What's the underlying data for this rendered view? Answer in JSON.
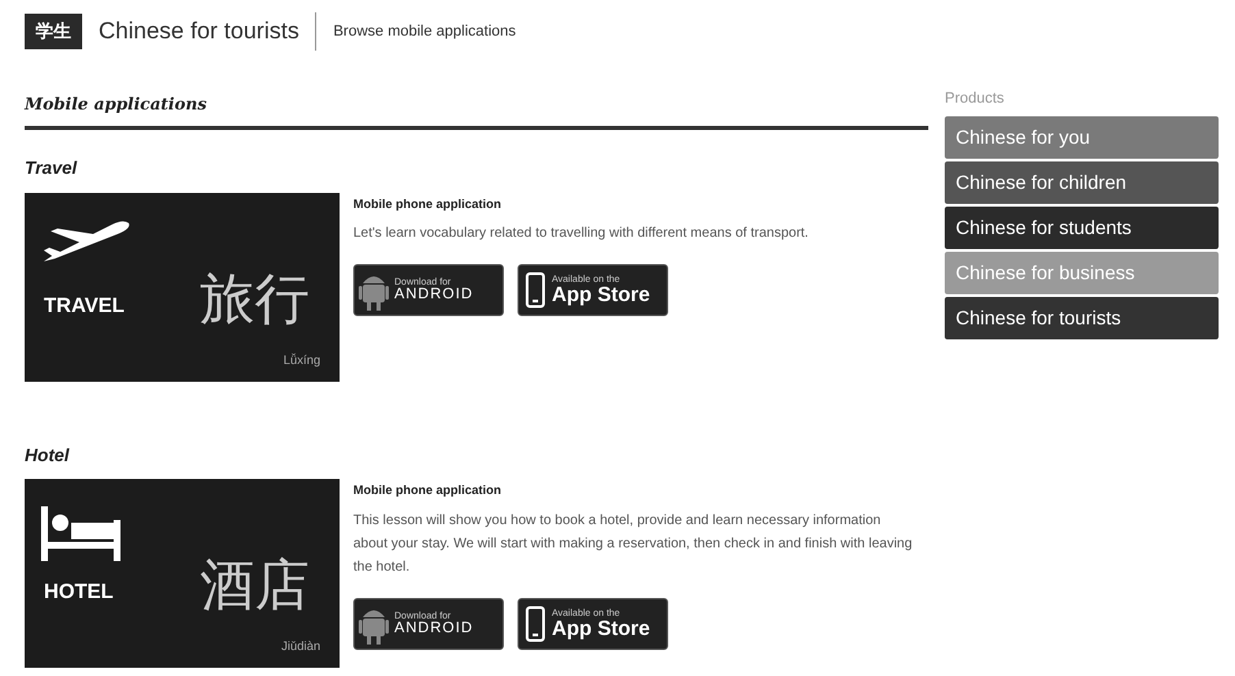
{
  "header": {
    "logo": "学生",
    "title": "Chinese for tourists",
    "link": "Browse mobile applications"
  },
  "section_title": "Mobile applications",
  "apps": [
    {
      "kind": "travel",
      "title": "Travel",
      "label": "TRAVEL",
      "hanzi": "旅行",
      "pinyin": "Lǚxíng",
      "subtitle": "Mobile phone application",
      "description": "Let's learn vocabulary related to travelling with different means of transport.",
      "android": {
        "top": "Download for",
        "bottom": "ANDROID"
      },
      "appstore": {
        "top": "Available on the",
        "bottom": "App Store"
      }
    },
    {
      "kind": "hotel",
      "title": "Hotel",
      "label": "HOTEL",
      "hanzi": "酒店",
      "pinyin": "Jiǔdiàn",
      "subtitle": "Mobile phone application",
      "description": "This lesson will show you how to book a hotel, provide and learn necessary information about your stay. We will start with making a reservation, then check in and finish with leaving the hotel.",
      "android": {
        "top": "Download for",
        "bottom": "ANDROID"
      },
      "appstore": {
        "top": "Available on the",
        "bottom": "App Store"
      }
    }
  ],
  "sidebar": {
    "title": "Products",
    "items": [
      {
        "label": "Chinese for you",
        "color": "#7a7a7a"
      },
      {
        "label": "Chinese for children",
        "color": "#555555"
      },
      {
        "label": "Chinese for students",
        "color": "#2b2b2b"
      },
      {
        "label": "Chinese for business",
        "color": "#9a9a9a"
      },
      {
        "label": "Chinese for tourists",
        "color": "#333333"
      }
    ]
  }
}
